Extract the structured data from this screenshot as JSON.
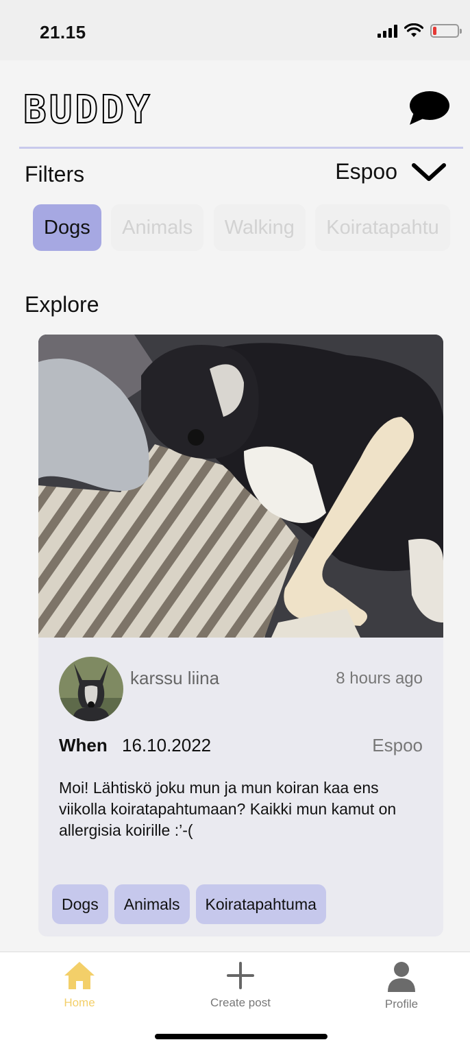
{
  "status_bar": {
    "time": "21.15"
  },
  "header": {
    "logo": "BUDDY",
    "chat_icon": "chat-bubble-icon"
  },
  "filters": {
    "label": "Filters",
    "location": "Espoo",
    "chips": [
      {
        "label": "Dogs",
        "active": true
      },
      {
        "label": "Animals",
        "active": false
      },
      {
        "label": "Walking",
        "active": false
      },
      {
        "label": "Koiratapahtu",
        "active": false
      }
    ]
  },
  "explore": {
    "title": "Explore",
    "post": {
      "author": "karssu liina",
      "time_ago": "8 hours ago",
      "when_label": "When",
      "date": "16.10.2022",
      "location": "Espoo",
      "description": "Moi! Lähtiskö joku mun ja mun koiran kaa ens viikolla koiratapahtumaan? Kaikki mun kamut on allergisia koirille :’-(",
      "tags": [
        "Dogs",
        "Animals",
        "Koiratapahtuma"
      ]
    }
  },
  "tab_bar": {
    "home": "Home",
    "create_post": "Create post",
    "profile": "Profile",
    "colors": {
      "active": "#f3cf69",
      "inactive": "#777777"
    }
  }
}
